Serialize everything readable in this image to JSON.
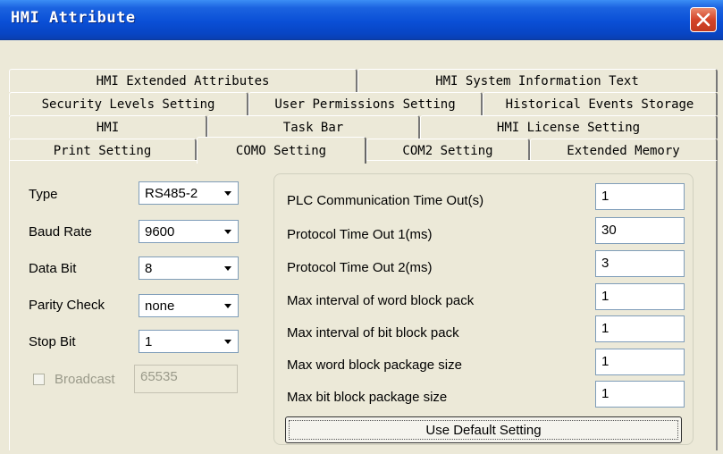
{
  "window": {
    "title": "HMI Attribute",
    "close_icon": "close-icon",
    "accent": "#0a4fd6",
    "close_color": "#d4452a"
  },
  "tabs": {
    "row1": [
      "HMI Extended Attributes",
      "HMI System Information Text"
    ],
    "row2": [
      "Security Levels Setting",
      "User Permissions Setting",
      "Historical Events Storage"
    ],
    "row3": [
      "HMI",
      "Task Bar",
      "HMI License Setting"
    ],
    "row4": [
      "Print Setting",
      "COMO Setting",
      "COM2 Setting",
      "Extended Memory"
    ],
    "active": "COMO Setting"
  },
  "left": {
    "type_label": "Type",
    "type_value": "RS485-2",
    "baud_label": "Baud Rate",
    "baud_value": "9600",
    "databit_label": "Data Bit",
    "databit_value": "8",
    "parity_label": "Parity Check",
    "parity_value": "none",
    "stopbit_label": "Stop Bit",
    "stopbit_value": "1",
    "broadcast_label": "Broadcast",
    "broadcast_checked": false,
    "broadcast_value": "65535"
  },
  "params": [
    {
      "label": "PLC Communication Time Out(s)",
      "value": "1"
    },
    {
      "label": "Protocol Time Out 1(ms)",
      "value": "30"
    },
    {
      "label": "Protocol Time Out 2(ms)",
      "value": "3"
    },
    {
      "label": "Max interval of word block pack",
      "value": "1"
    },
    {
      "label": "Max interval of bit block pack",
      "value": "1"
    },
    {
      "label": "Max word block package size",
      "value": "1"
    },
    {
      "label": "Max bit block package size",
      "value": "1"
    }
  ],
  "default_button": "Use Default Setting"
}
